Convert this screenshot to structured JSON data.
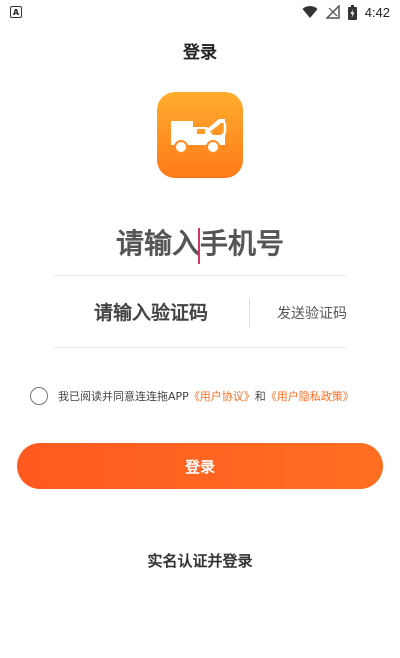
{
  "status_bar": {
    "app_icon": "A",
    "time": "4:42",
    "icons": [
      "wifi-icon",
      "signal-icon",
      "battery-icon"
    ]
  },
  "page": {
    "title": "登录"
  },
  "logo": {
    "icon": "tow-truck-icon",
    "gradient": [
      "#ffad2e",
      "#ff7a1a"
    ]
  },
  "form": {
    "phone_placeholder": "请输入手机号",
    "code_placeholder": "请输入验证码",
    "send_code_label": "发送验证码"
  },
  "agreement": {
    "prefix": "我已阅读并同意连连拖APP",
    "user_agreement": "《用户协议》",
    "and": "和",
    "privacy_policy": "《用户隐私政策》",
    "checked": false
  },
  "actions": {
    "login_label": "登录",
    "realname_label": "实名认证并登录"
  },
  "colors": {
    "accent": "#ff6a1f",
    "cursor": "#d6336c"
  }
}
